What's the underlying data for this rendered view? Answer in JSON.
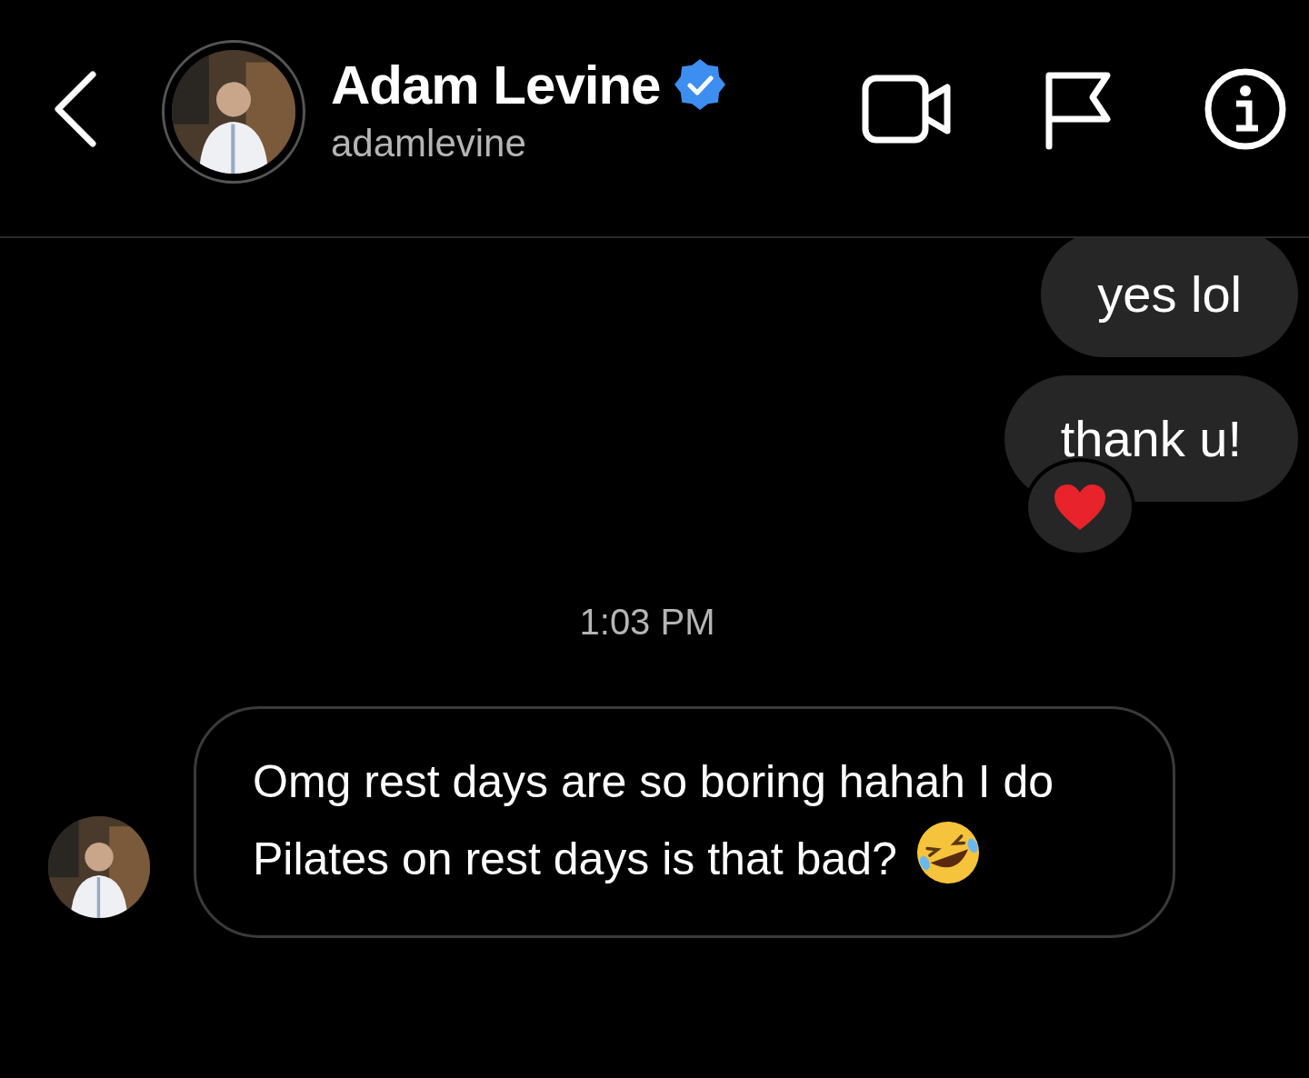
{
  "header": {
    "name": "Adam Levine",
    "verified": true,
    "username": "adamlevine",
    "actions": [
      {
        "kind": "video"
      },
      {
        "kind": "flag"
      },
      {
        "kind": "info"
      }
    ]
  },
  "messages": [
    {
      "kind": "outgoing",
      "text": "yes lol"
    },
    {
      "kind": "outgoing",
      "text": "thank u!",
      "reaction": {
        "kind": "heart"
      }
    },
    {
      "kind": "timestamp",
      "text": "1:03 PM"
    },
    {
      "kind": "incoming",
      "text": "Omg rest days are so boring hahah I do Pilates on rest days is that bad?",
      "emoji": {
        "kind": "laugh"
      },
      "avatar": true
    }
  ]
}
